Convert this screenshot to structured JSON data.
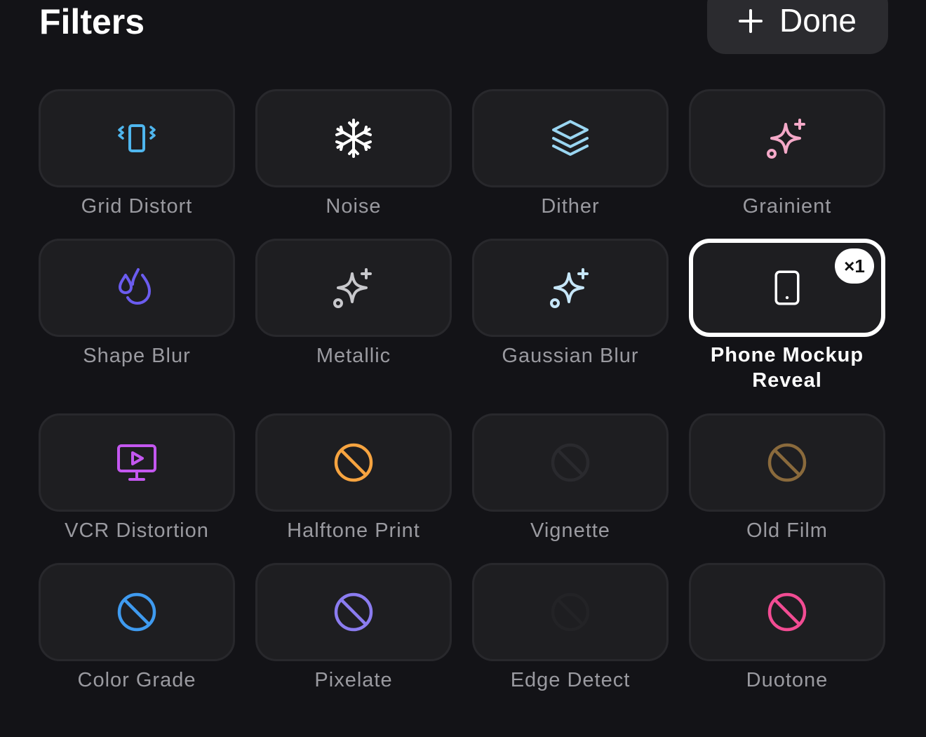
{
  "header": {
    "title": "Filters",
    "done_label": "Done",
    "done_icon": "plus-icon"
  },
  "colors": {
    "background": "#131317",
    "tile": "#1e1e21",
    "tile_border": "#28282c",
    "label": "#9a9aa0",
    "selected_border": "#ffffff"
  },
  "filters": [
    {
      "label": "Grid Distort",
      "icon": "vibrate-icon",
      "color": "#4fb6ee",
      "selected": false
    },
    {
      "label": "Noise",
      "icon": "snowflake-icon",
      "color": "#ffffff",
      "selected": false
    },
    {
      "label": "Dither",
      "icon": "layers-icon",
      "color": "#9ad6f2",
      "selected": false
    },
    {
      "label": "Grainient",
      "icon": "sparkles-icon",
      "color": "#f4a9c8",
      "selected": false
    },
    {
      "label": "Shape Blur",
      "icon": "droplets-icon",
      "color": "#6b5cf0",
      "selected": false
    },
    {
      "label": "Metallic",
      "icon": "sparkles-icon",
      "color": "#c8c8cc",
      "selected": false
    },
    {
      "label": "Gaussian Blur",
      "icon": "sparkles-icon",
      "color": "#c6e6f8",
      "selected": false
    },
    {
      "label": "Phone Mockup Reveal",
      "icon": "tablet-icon",
      "color": "#ffffff",
      "selected": true,
      "badge": "×1"
    },
    {
      "label": "VCR Distortion",
      "icon": "monitor-play-icon",
      "color": "#c457f0",
      "selected": false
    },
    {
      "label": "Halftone Print",
      "icon": "ban-icon",
      "color": "#f7a440",
      "selected": false
    },
    {
      "label": "Vignette",
      "icon": "ban-icon",
      "color": "#2a2a2e",
      "selected": false
    },
    {
      "label": "Old Film",
      "icon": "ban-icon",
      "color": "#8a6a3c",
      "selected": false
    },
    {
      "label": "Color Grade",
      "icon": "ban-icon",
      "color": "#3f9bf0",
      "selected": false
    },
    {
      "label": "Pixelate",
      "icon": "ban-icon",
      "color": "#8b7cf0",
      "selected": false
    },
    {
      "label": "Edge Detect",
      "icon": "ban-icon",
      "color": "#232326",
      "selected": false
    },
    {
      "label": "Duotone",
      "icon": "ban-icon",
      "color": "#f24c93",
      "selected": false
    }
  ]
}
